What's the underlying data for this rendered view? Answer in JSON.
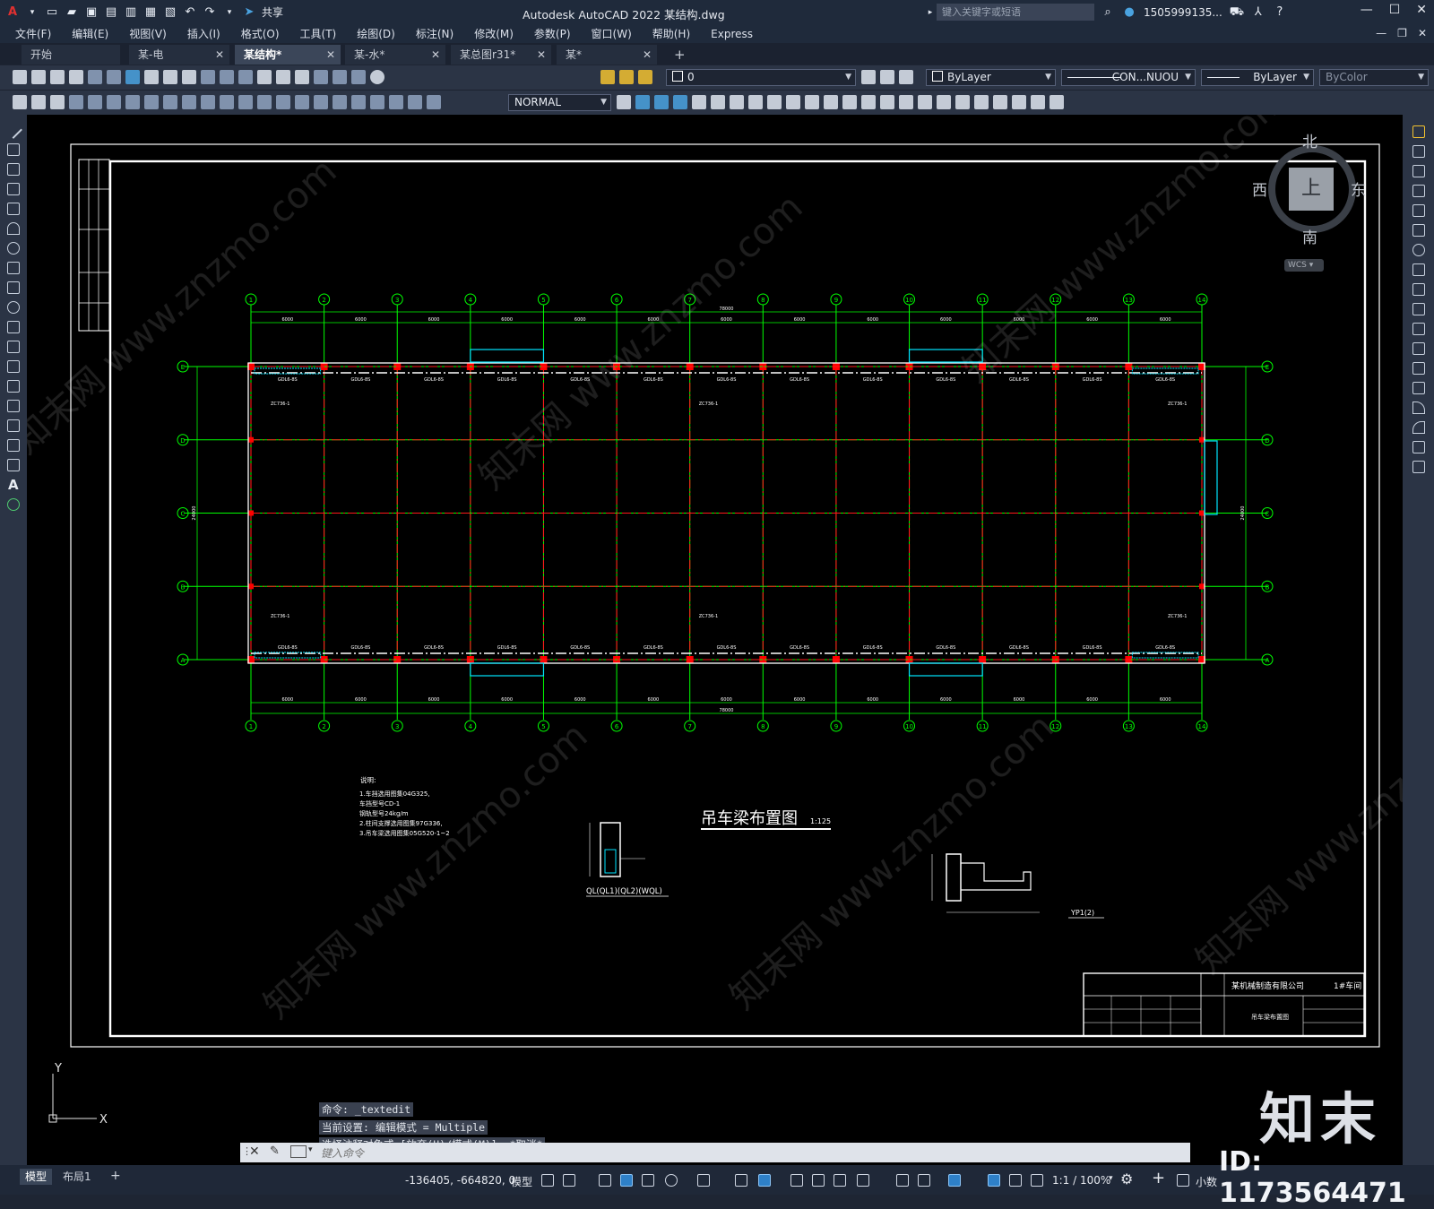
{
  "app": {
    "title": "Autodesk AutoCAD 2022    某结构.dwg",
    "search_placeholder": "键入关键字或短语",
    "user": "1505999135...",
    "share_label": "共享"
  },
  "menu": [
    "文件(F)",
    "编辑(E)",
    "视图(V)",
    "插入(I)",
    "格式(O)",
    "工具(T)",
    "绘图(D)",
    "标注(N)",
    "修改(M)",
    "参数(P)",
    "窗口(W)",
    "帮助(H)",
    "Express"
  ],
  "tabs": [
    {
      "label": "开始",
      "active": false
    },
    {
      "label": "某-电",
      "active": false
    },
    {
      "label": "某结构*",
      "active": true
    },
    {
      "label": "某-水*",
      "active": false
    },
    {
      "label": "某总图r31*",
      "active": false
    },
    {
      "label": "某*",
      "active": false
    }
  ],
  "properties": {
    "layer": "0",
    "color": "ByLayer",
    "linetype": "CON...NUOU",
    "lineweight": "ByLayer",
    "plotstyle": "ByColor",
    "textstyle": "NORMAL"
  },
  "viewcube": {
    "north": "北",
    "south": "南",
    "west": "西",
    "east": "东",
    "top": "上",
    "wcs": "WCS"
  },
  "drawing": {
    "grid_numbers": [
      "1",
      "2",
      "3",
      "4",
      "5",
      "6",
      "7",
      "8",
      "9",
      "10",
      "11",
      "12",
      "13",
      "14"
    ],
    "grid_letters": [
      "E",
      "D",
      "C",
      "B",
      "A"
    ],
    "span": "6000",
    "total_length": "78000",
    "total_width": "24000",
    "side_span": "6000",
    "beam_label": "GDL6-8S",
    "crane_label": "ZC736-1",
    "title": "吊车梁布置图",
    "scale": "1:125",
    "notes_title": "说明:",
    "notes": [
      "1.车挡选用图集04G325,",
      "  车挡型号CD-1",
      "  钢轨型号24kg/m",
      "2.柱间支撑选用图集97G336,",
      "3.吊车梁选用图集05G520-1~2"
    ],
    "detail1_label": "QL(QL1)(QL2)(WQL)",
    "detail2_label": "YP1(2)",
    "company": "某机械制造有限公司",
    "workshop": "1#车间",
    "sheet_title": "吊车梁布置图"
  },
  "command": {
    "history": [
      "命令:  _textedit",
      "当前设置: 编辑模式 = Multiple",
      "选择注释对象或 [放弃(U)/模式(M)]: *取消*"
    ],
    "placeholder": "键入命令"
  },
  "status": {
    "layout_tabs": [
      "模型",
      "布局1"
    ],
    "coords": "-136405, -664820, 0",
    "model_label": "模型",
    "scale": "1:1 / 100%",
    "units": "小数"
  },
  "watermark": {
    "logo": "知末",
    "id": "ID: 1173564471"
  },
  "colors": {
    "grid": "#00ff00",
    "axis": "#ff1a1a",
    "frame": "#ffffff",
    "cyan": "#00e5ff",
    "background": "#000000"
  }
}
